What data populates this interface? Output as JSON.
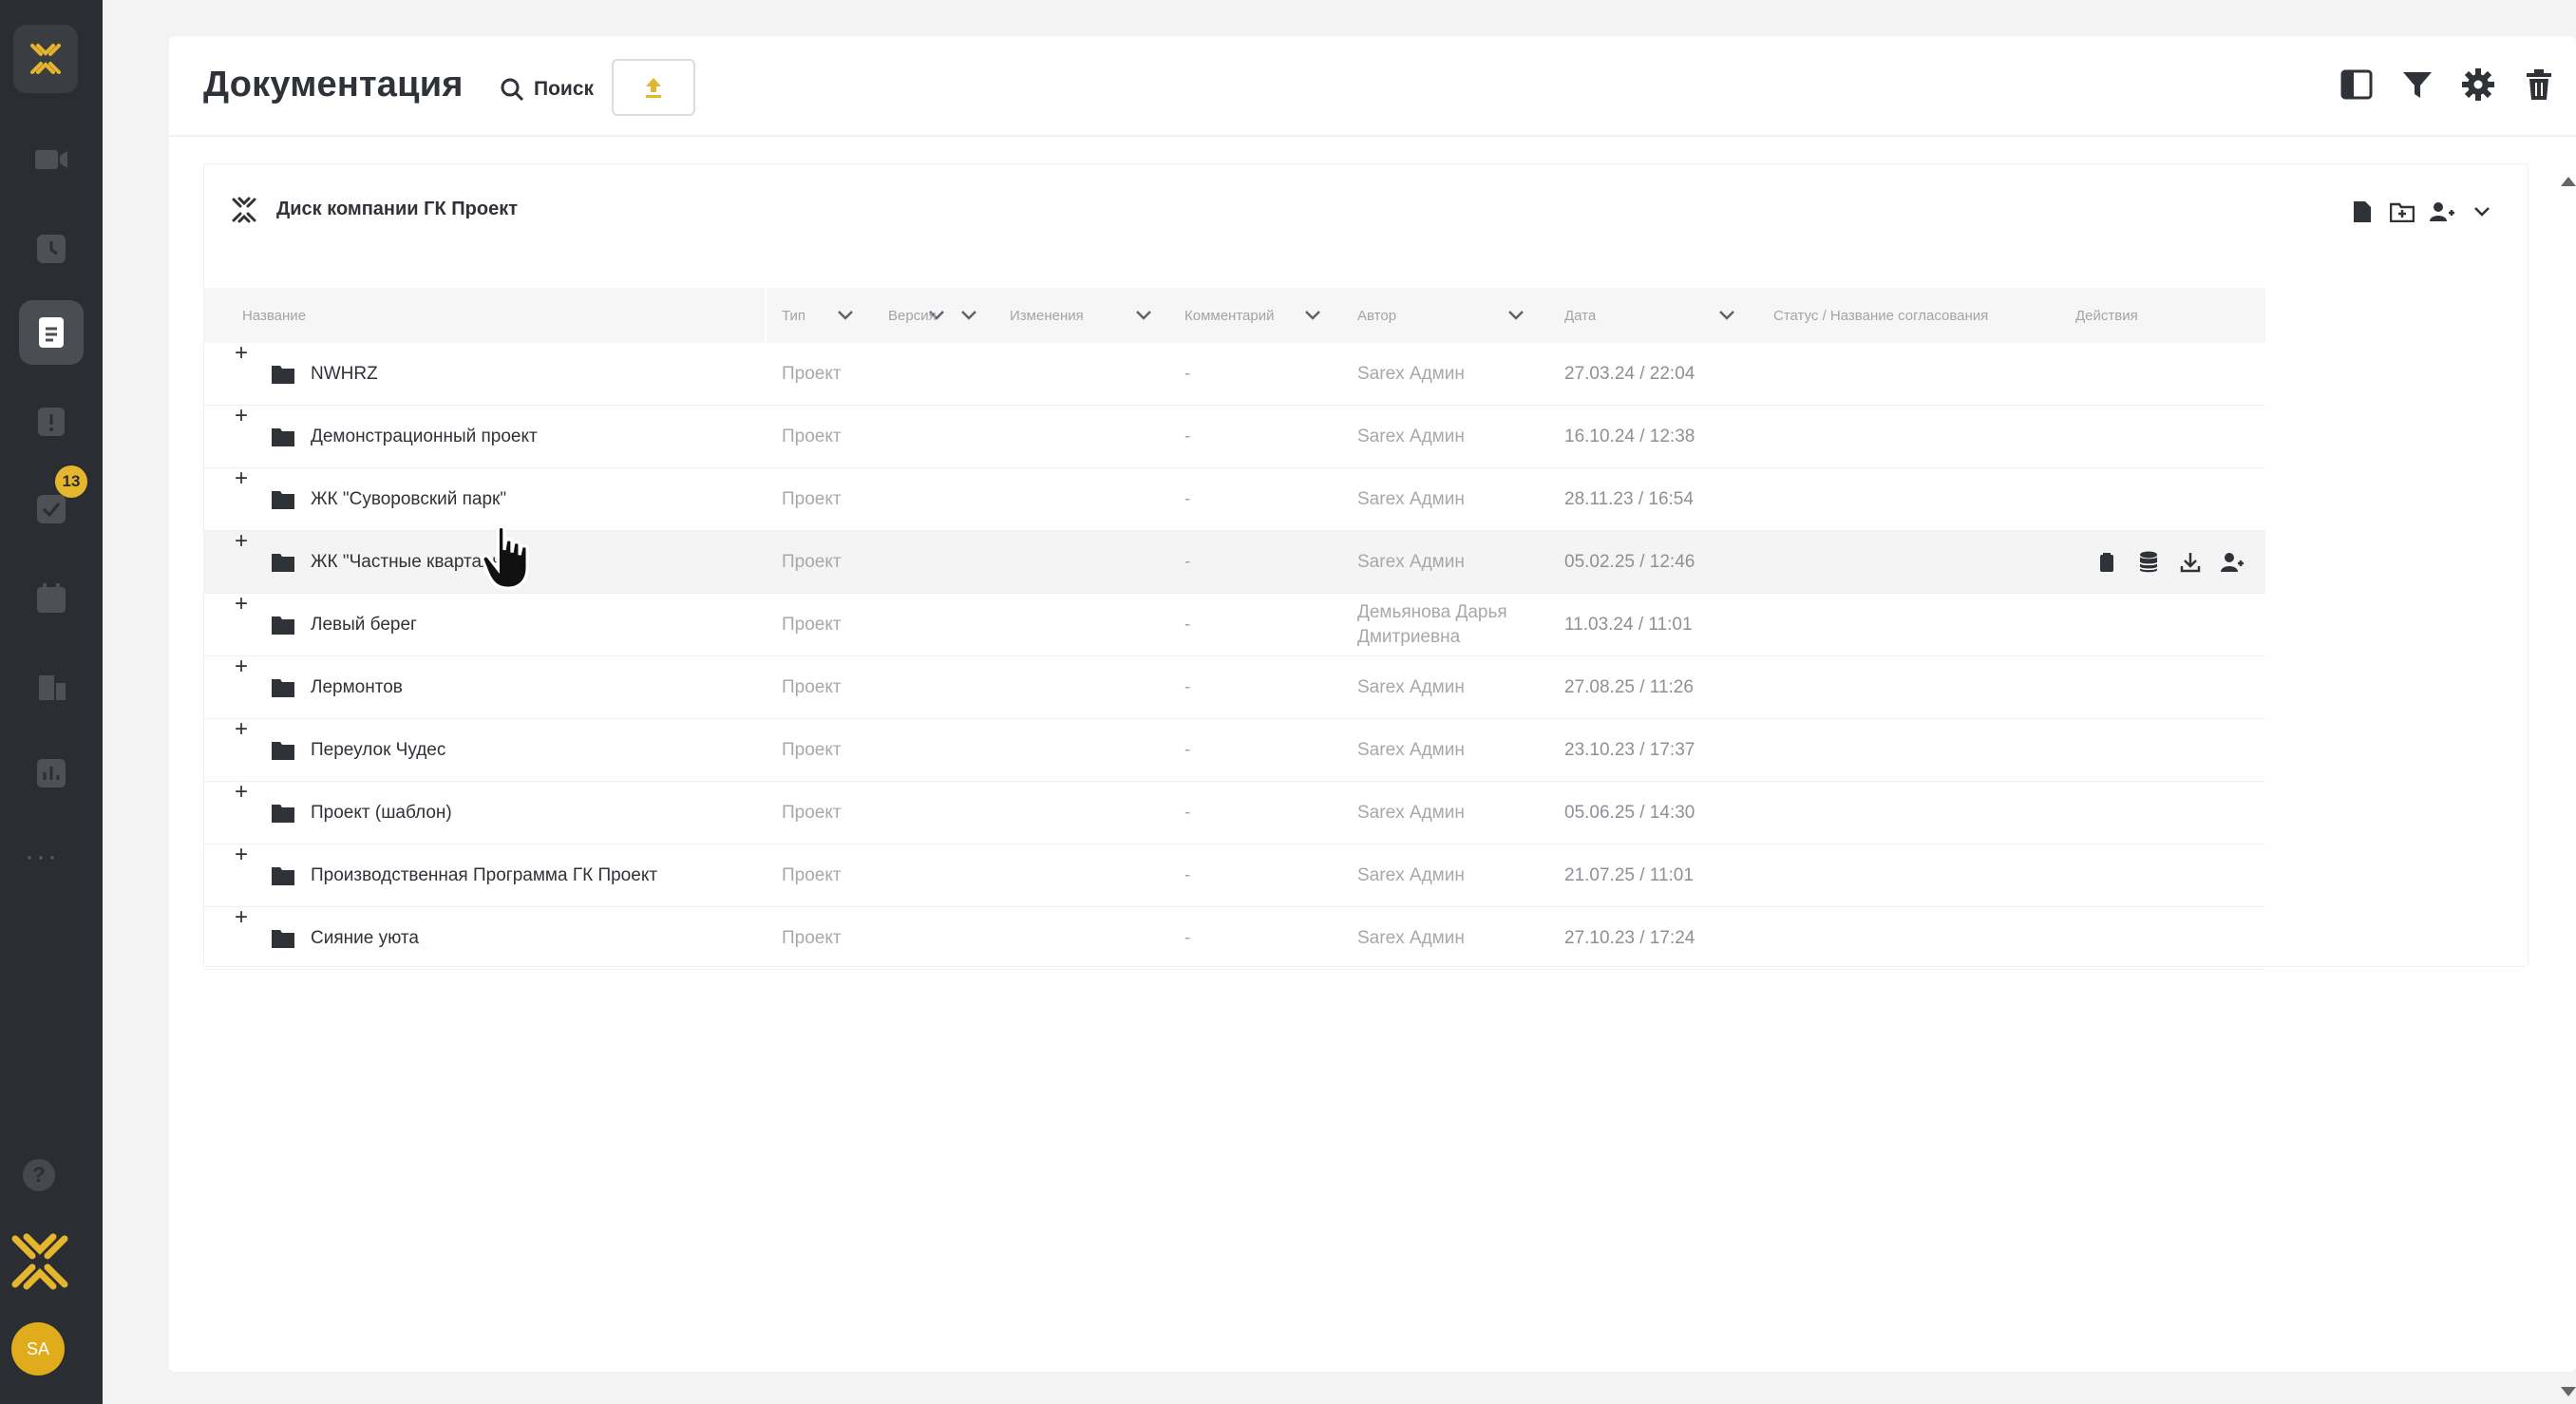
{
  "app": {
    "title": "Документация",
    "search_label": "Поиск"
  },
  "sidebar": {
    "notification_count": "13",
    "avatar_initials": "SA",
    "items": [
      {
        "icon": "video-icon"
      },
      {
        "icon": "clock-icon"
      },
      {
        "icon": "document-icon",
        "active": true
      },
      {
        "icon": "alert-icon"
      },
      {
        "icon": "task-check-icon"
      },
      {
        "icon": "calendar-icon"
      },
      {
        "icon": "building-icon"
      },
      {
        "icon": "report-icon"
      }
    ]
  },
  "panel": {
    "title": "Диск компании ГК Проект"
  },
  "table": {
    "columns": {
      "name": "Название",
      "type": "Тип",
      "version": "Версия",
      "changes": "Изменения",
      "comment": "Комментарий",
      "author": "Автор",
      "date": "Дата",
      "status": "Статус / Название согласования",
      "actions": "Действия"
    },
    "rows": [
      {
        "name": "NWHRZ",
        "type": "Проект",
        "comment": "-",
        "author": "Sarex Админ",
        "date": "27.03.24 / 22:04"
      },
      {
        "name": "Демонстрационный проект",
        "type": "Проект",
        "comment": "-",
        "author": "Sarex Админ",
        "date": "16.10.24 / 12:38"
      },
      {
        "name": "ЖК \"Суворовский парк\"",
        "type": "Проект",
        "comment": "-",
        "author": "Sarex Админ",
        "date": "28.11.23 / 16:54"
      },
      {
        "name": "ЖК \"Частные кварталы\"",
        "type": "Проект",
        "comment": "-",
        "author": "Sarex Админ",
        "date": "05.02.25 / 12:46"
      },
      {
        "name": "Левый берег",
        "type": "Проект",
        "comment": "-",
        "author": "Демьянова Дарья Дмитриевна",
        "date": "11.03.24 / 11:01"
      },
      {
        "name": "Лермонтов",
        "type": "Проект",
        "comment": "-",
        "author": "Sarex Админ",
        "date": "27.08.25 / 11:26"
      },
      {
        "name": "Переулок Чудес",
        "type": "Проект",
        "comment": "-",
        "author": "Sarex Админ",
        "date": "23.10.23 / 17:37"
      },
      {
        "name": "Проект (шаблон)",
        "type": "Проект",
        "comment": "-",
        "author": "Sarex Админ",
        "date": "05.06.25 / 14:30"
      },
      {
        "name": "Производственная Программа ГК Проект",
        "type": "Проект",
        "comment": "-",
        "author": "Sarex Админ",
        "date": "21.07.25 / 11:01"
      },
      {
        "name": "Сияние уюта",
        "type": "Проект",
        "comment": "-",
        "author": "Sarex Админ",
        "date": "27.10.23 / 17:24"
      }
    ]
  },
  "colors": {
    "accent": "#e6b52e",
    "sidebar": "#2a2d31"
  }
}
